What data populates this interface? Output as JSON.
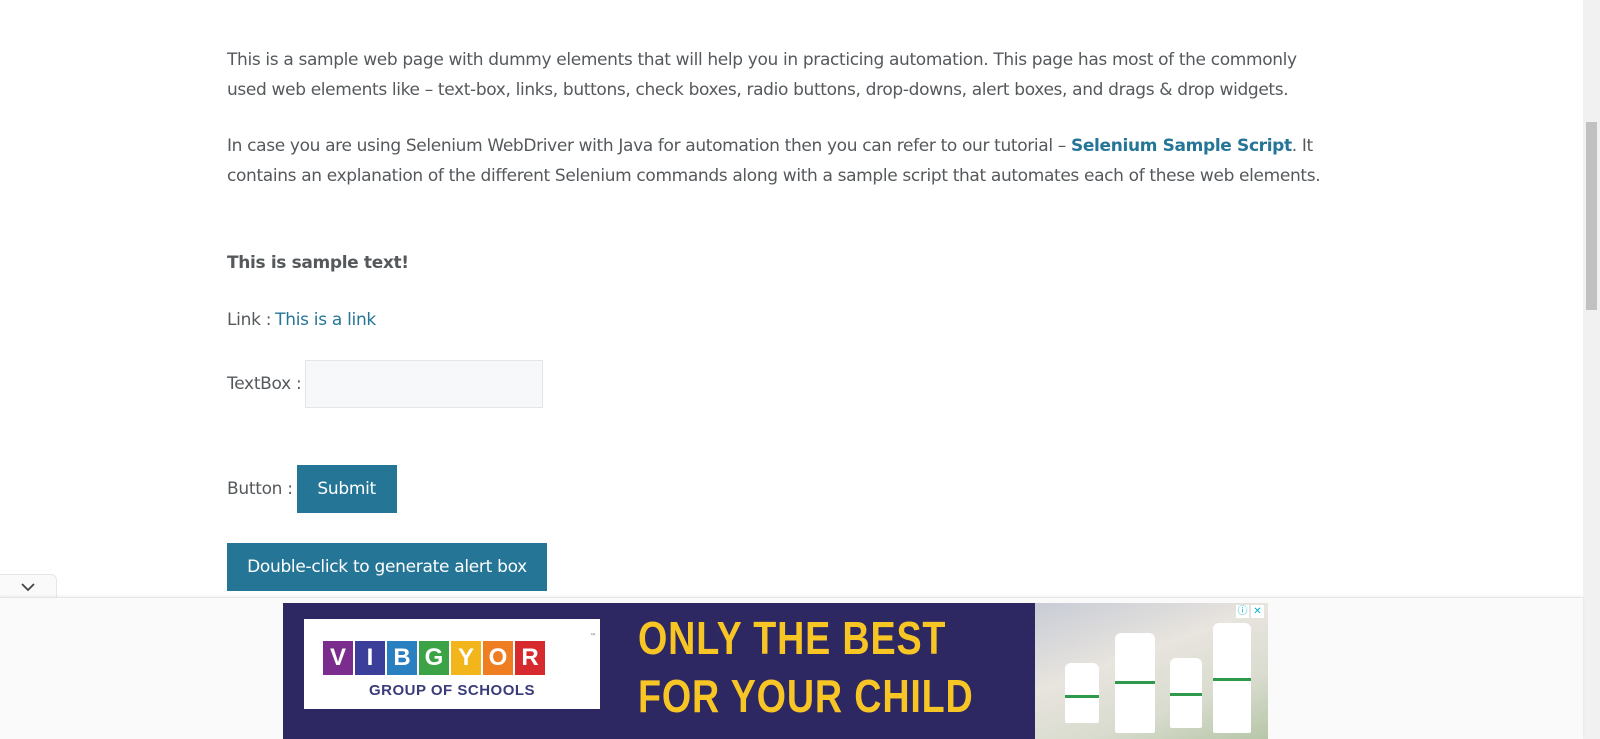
{
  "intro": {
    "para1": "This is a sample web page with dummy elements that will help you in practicing automation. This page has most of the commonly used web elements like – text-box, links, buttons, check boxes, radio buttons, drop-downs, alert boxes, and drags & drop widgets.",
    "para2_before": "In case you are using Selenium WebDriver with Java for automation then you can refer to our tutorial – ",
    "para2_link": "Selenium Sample Script",
    "para2_after": ". It contains an explanation of the different Selenium commands along with a sample script that automates each of these web elements."
  },
  "sample_text": "This is sample text!",
  "link_row": {
    "label": "Link :",
    "link_text": "This is a link"
  },
  "textbox_row": {
    "label": "TextBox :",
    "value": "",
    "placeholder": ""
  },
  "button_row": {
    "label": "Button :",
    "button_label": "Submit"
  },
  "double_click_button": "Double-click to generate alert box",
  "ad": {
    "logo_letters": [
      {
        "char": "V",
        "color": "#7b2d8e"
      },
      {
        "char": "I",
        "color": "#3b3f99"
      },
      {
        "char": "B",
        "color": "#2a7fc1"
      },
      {
        "char": "G",
        "color": "#3ba346"
      },
      {
        "char": "Y",
        "color": "#f2b51b"
      },
      {
        "char": "O",
        "color": "#ef7d22"
      },
      {
        "char": "R",
        "color": "#d72a2f"
      }
    ],
    "tm": "™",
    "logo_subtitle": "GROUP OF SCHOOLS",
    "headline_line1": "ONLY THE BEST",
    "headline_line2": "FOR YOUR CHILD",
    "info_glyph": "ⓘ",
    "close_glyph": "✕"
  },
  "icons": {
    "collapse": "chevron-down-icon",
    "ad_info": "info-icon",
    "ad_close": "close-icon"
  },
  "colors": {
    "accent": "#257597",
    "text": "#55595c",
    "ad_background": "#2d2762",
    "ad_headline": "#f7c524"
  }
}
